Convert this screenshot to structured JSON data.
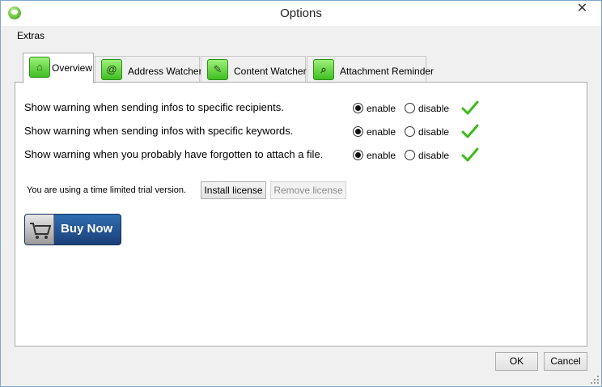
{
  "window": {
    "title": "Options",
    "close_glyph": "✕"
  },
  "menu": {
    "extras": "Extras"
  },
  "tabs": [
    {
      "label": "Overview",
      "icon": "home-icon",
      "glyph": "⌂",
      "active": true
    },
    {
      "label": "Address Watcher",
      "icon": "at-icon",
      "glyph": "@",
      "active": false
    },
    {
      "label": "Content Watcher",
      "icon": "edit-icon",
      "glyph": "✎",
      "active": false
    },
    {
      "label": "Attachment Reminder",
      "icon": "paperclip-icon",
      "glyph": "⌕",
      "active": false
    }
  ],
  "rules": [
    {
      "text": "Show warning when sending infos to specific recipients.",
      "enable": "enable",
      "disable": "disable",
      "selected": "enable"
    },
    {
      "text": "Show warning when sending infos with specific keywords.",
      "enable": "enable",
      "disable": "disable",
      "selected": "enable"
    },
    {
      "text": "Show warning when you probably have forgotten to attach a file.",
      "enable": "enable",
      "disable": "disable",
      "selected": "enable"
    }
  ],
  "license": {
    "trial_text": "You are using a time limited trial version.",
    "install_label": "Install license",
    "remove_label": "Remove license"
  },
  "buy": {
    "label": "Buy Now"
  },
  "footer": {
    "ok_label": "OK",
    "cancel_label": "Cancel"
  },
  "colors": {
    "check_green": "#3dba1e",
    "accent_blue": "#1b3f78",
    "tab_icon_green": "#4cc52b"
  }
}
